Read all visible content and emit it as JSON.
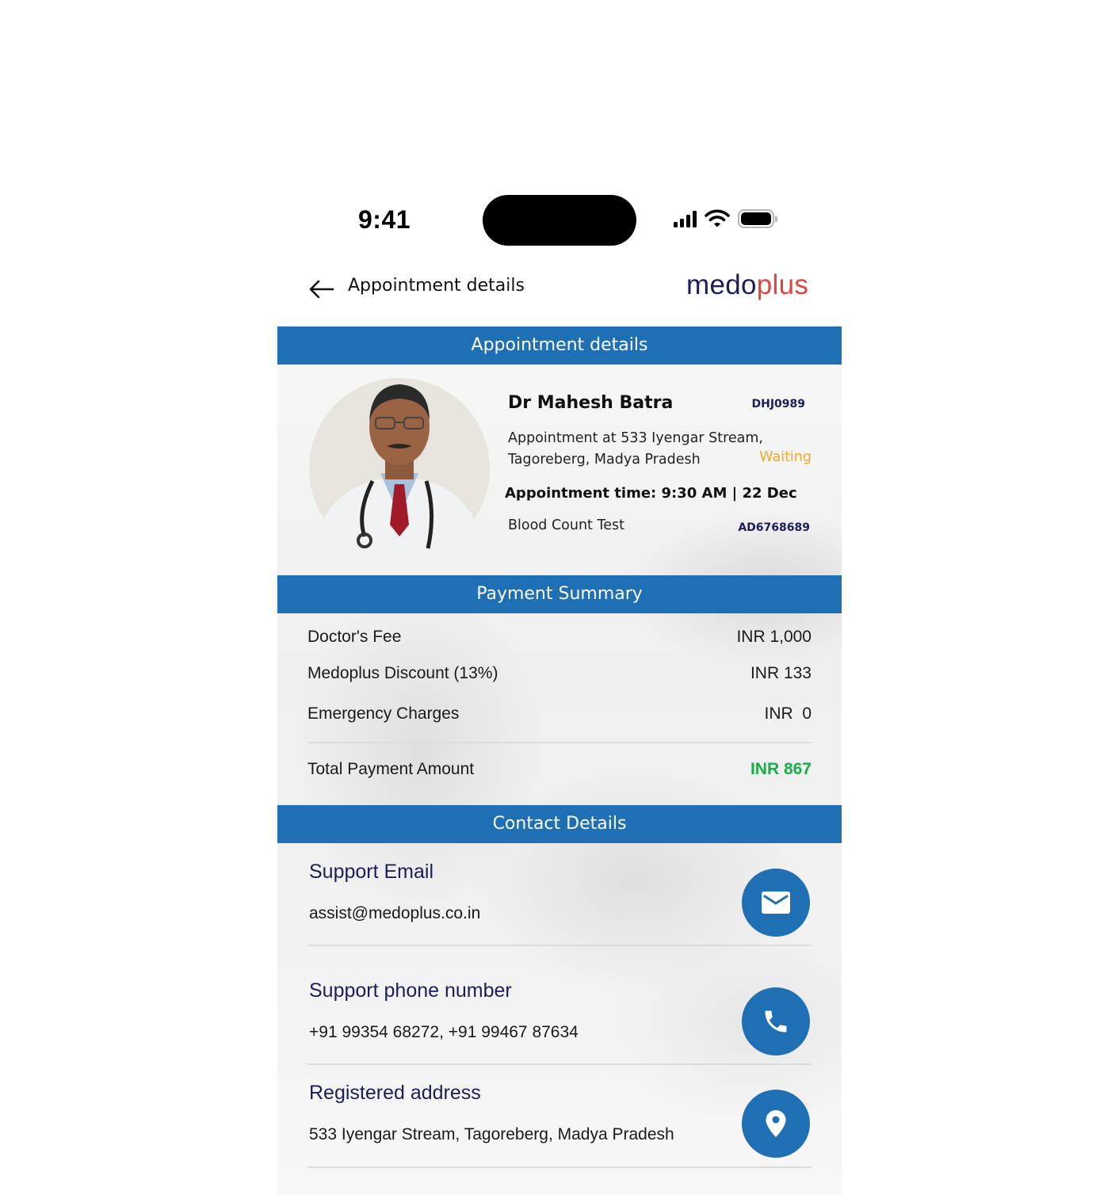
{
  "status_bar": {
    "time": "9:41",
    "icons": [
      "cellular-signal-icon",
      "wifi-icon",
      "battery-icon"
    ]
  },
  "header": {
    "back_icon": "arrow-left-icon",
    "title": "Appointment details",
    "brand": {
      "part1": "medo",
      "part2": "plus"
    }
  },
  "colors": {
    "accent": "#1f6fb5",
    "brand_dark": "#1b1e5c",
    "brand_red": "#e0453e",
    "status_waiting": "#f5a623",
    "total_green": "#1aac48"
  },
  "appointment": {
    "section_title": "Appointment details",
    "doctor_name": "Dr Mahesh Batra",
    "doctor_id": "DHJ0989",
    "address_line1": "Appointment at 533 Iyengar Stream,",
    "address_line2": "Tagoreberg, Madya Pradesh",
    "status": "Waiting",
    "time_text": "Appointment time: 9:30 AM | 22 Dec",
    "test_name": "Blood Count Test",
    "appointment_id": "AD6768689"
  },
  "payment": {
    "section_title": "Payment Summary",
    "rows": [
      {
        "label": "Doctor's Fee",
        "value": "INR 1,000"
      },
      {
        "label": "Medoplus Discount (13%)",
        "value": "INR 133"
      },
      {
        "label": "Emergency Charges",
        "value": "INR  0"
      }
    ],
    "total": {
      "label": "Total Payment Amount",
      "value": "INR 867"
    }
  },
  "contact": {
    "section_title": "Contact Details",
    "items": [
      {
        "label": "Support Email",
        "value": "assist@medoplus.co.in",
        "icon": "mail-icon"
      },
      {
        "label": "Support phone number",
        "value": "+91 99354 68272, +91 99467 87634",
        "icon": "phone-icon"
      },
      {
        "label": "Registered address",
        "value": "533 Iyengar Stream, Tagoreberg, Madya Pradesh",
        "icon": "location-pin-icon"
      }
    ]
  }
}
